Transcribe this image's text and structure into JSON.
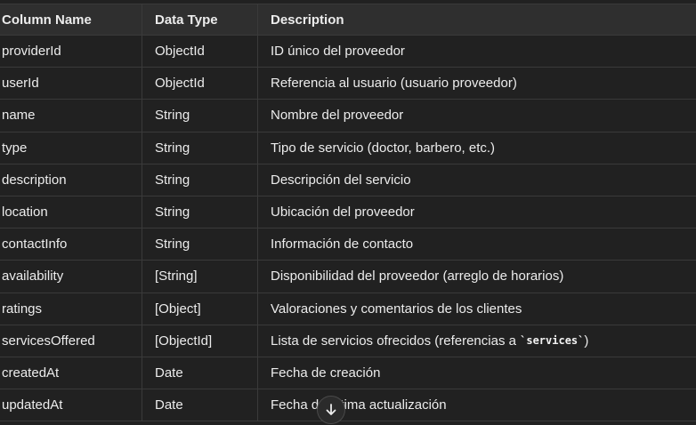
{
  "table": {
    "headers": [
      "Column Name",
      "Data Type",
      "Description"
    ],
    "rows": [
      {
        "name": "providerId",
        "type": "ObjectId",
        "desc": "ID único del proveedor"
      },
      {
        "name": "userId",
        "type": "ObjectId",
        "desc": "Referencia al usuario (usuario proveedor)"
      },
      {
        "name": "name",
        "type": "String",
        "desc": "Nombre del proveedor"
      },
      {
        "name": "type",
        "type": "String",
        "desc": "Tipo de servicio (doctor, barbero, etc.)"
      },
      {
        "name": "description",
        "type": "String",
        "desc": "Descripción del servicio"
      },
      {
        "name": "location",
        "type": "String",
        "desc": "Ubicación del proveedor"
      },
      {
        "name": "contactInfo",
        "type": "String",
        "desc": "Información de contacto"
      },
      {
        "name": "availability",
        "type": "[String]",
        "desc": "Disponibilidad del proveedor (arreglo de horarios)"
      },
      {
        "name": "ratings",
        "type": "[Object]",
        "desc": "Valoraciones y comentarios de los clientes"
      },
      {
        "name": "servicesOffered",
        "type": "[ObjectId]",
        "desc_prefix": "Lista de servicios ofrecidos (referencias a ",
        "desc_code": "`services`",
        "desc_suffix": ")"
      },
      {
        "name": "createdAt",
        "type": "Date",
        "desc": "Fecha de creación"
      },
      {
        "name": "updatedAt",
        "type": "Date",
        "desc": "Fecha de última actualización"
      }
    ]
  },
  "scroll_button": {
    "icon": "arrow-down-icon"
  }
}
